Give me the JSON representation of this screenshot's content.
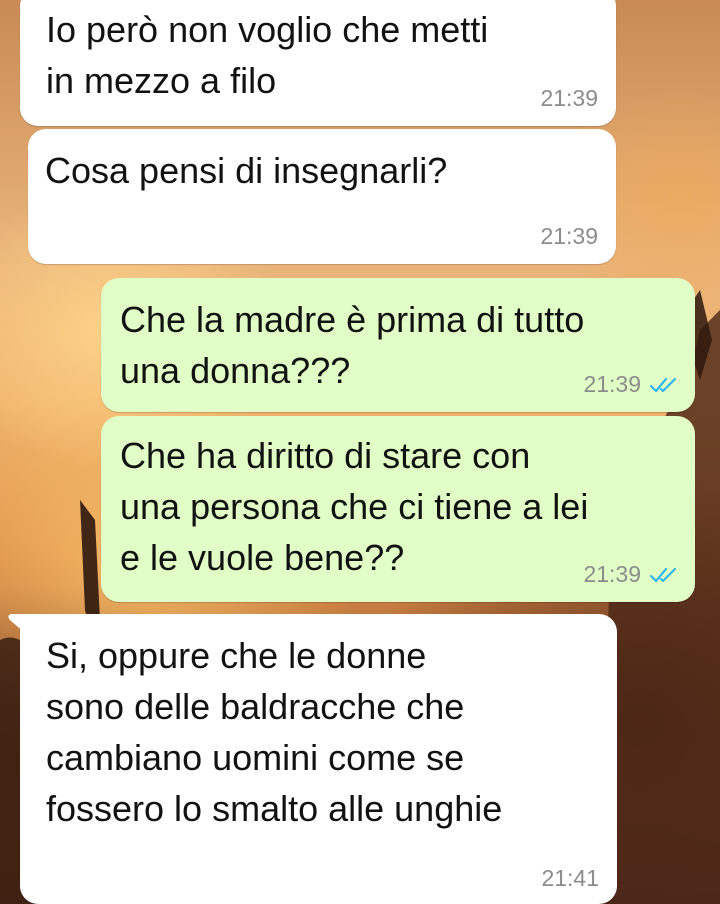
{
  "chat": {
    "messages": [
      {
        "direction": "in",
        "text": "Io però non voglio che metti\nin mezzo a filo",
        "time": "21:39"
      },
      {
        "direction": "in",
        "text": "Cosa pensi di insegnarli?",
        "time": "21:39"
      },
      {
        "direction": "out",
        "text": "Che la madre è prima di tutto\nuna donna???",
        "time": "21:39",
        "status": "read"
      },
      {
        "direction": "out",
        "text": "Che ha diritto di stare con\nuna persona che ci tiene a lei\ne le vuole bene??",
        "time": "21:39",
        "status": "read"
      },
      {
        "direction": "in",
        "text": "Si, oppure che le donne\nsono delle baldracche che\ncambiano uomini come se\nfossero lo smalto alle unghie",
        "time": "21:41"
      }
    ]
  },
  "colors": {
    "incoming_bubble": "#ffffff",
    "outgoing_bubble": "#e1fec6",
    "read_tick": "#34b7f1",
    "timestamp": "#8c8c8c"
  },
  "icons": {
    "read_receipt": "double-check-icon"
  }
}
